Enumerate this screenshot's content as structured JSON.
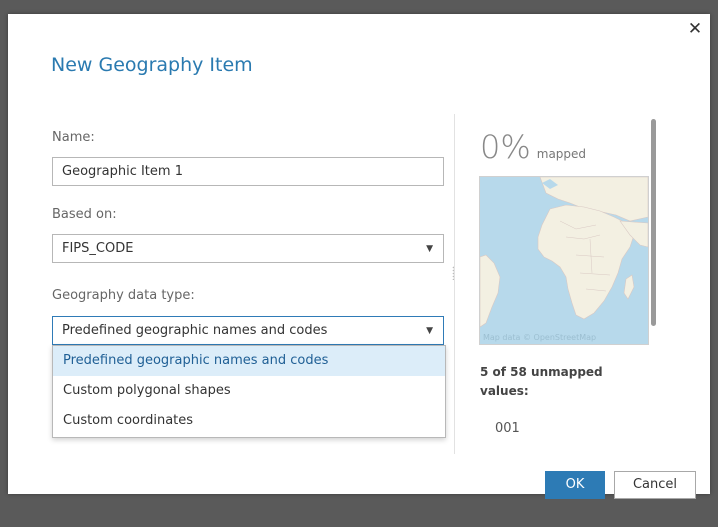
{
  "dialog": {
    "title": "New Geography Item",
    "close_icon": "close-icon"
  },
  "form": {
    "name_label": "Name:",
    "name_value": "Geographic Item 1",
    "based_on_label": "Based on:",
    "based_on_value": "FIPS_CODE",
    "geo_type_label": "Geography data type:",
    "geo_type_value": "Predefined geographic names and codes",
    "options": [
      "Predefined geographic names and codes",
      "Custom polygonal shapes",
      "Custom coordinates"
    ],
    "dropdown_arrow": "▼"
  },
  "mapping": {
    "percent": "0%",
    "percent_label": "mapped",
    "map_credit": "Map data © OpenStreetMap",
    "unmapped_summary": "5 of 58 unmapped values:",
    "first_code": "001"
  },
  "buttons": {
    "ok": "OK",
    "cancel": "Cancel"
  },
  "colors": {
    "accent": "#2d7bb5",
    "title": "#2a7ab0",
    "selected_option_bg": "#dcedf9",
    "map_water": "#b7d9eb",
    "map_land": "#f3f0e2"
  }
}
